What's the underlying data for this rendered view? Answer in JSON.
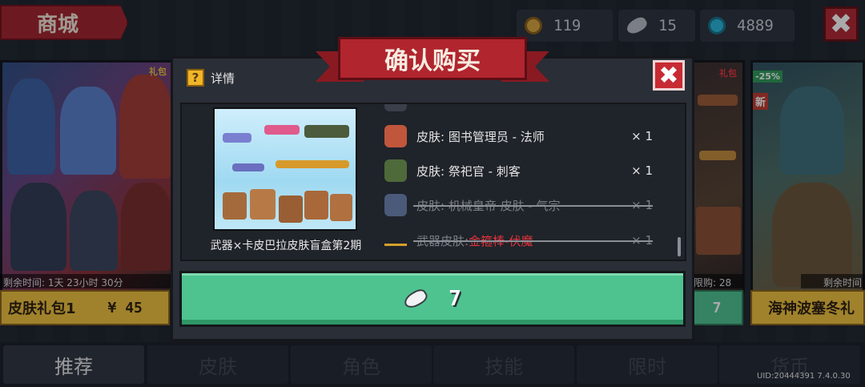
{
  "topbar": {
    "title": "商城",
    "currencies": [
      {
        "icon": "coin-icon",
        "value": "119"
      },
      {
        "icon": "fish-icon",
        "value": "15"
      },
      {
        "icon": "gem-icon",
        "value": "4889"
      }
    ],
    "close_label": "✖"
  },
  "background_cards": {
    "left": {
      "tag": "礼包",
      "remaining": "剩余时间: 1天 23小时 30分",
      "name": "皮肤礼包1",
      "price": "¥ 45"
    },
    "mid": {
      "tag": "礼包",
      "limit": "限购: 28",
      "price": "7"
    },
    "right": {
      "discount": "-25%",
      "new": "新",
      "remaining": "剩余时间",
      "name": "海神波塞冬礼"
    }
  },
  "dialog": {
    "banner": "确认购买",
    "header": "详情",
    "help_icon": "?",
    "close_label": "✖",
    "preview_name": "武器×卡皮巴拉皮肤盲盒第2期",
    "items": [
      {
        "label": "皮肤: 图书管理员 - 法师",
        "qty": "× 1",
        "struck": false
      },
      {
        "label": "皮肤: 祭祀官 - 刺客",
        "qty": "× 1",
        "struck": false
      },
      {
        "label": "皮肤: 机械皇帝 皮肤 - 气宗",
        "qty": "× 1",
        "struck": true
      },
      {
        "label_prefix": "武器皮肤: ",
        "label_highlight": "金箍棒-伏魔",
        "qty": "× 1",
        "struck": true
      }
    ],
    "buy": {
      "icon": "fish-icon",
      "price": "7"
    }
  },
  "tabs": [
    {
      "label": "推荐",
      "active": true
    },
    {
      "label": "皮肤",
      "active": false
    },
    {
      "label": "角色",
      "active": false
    },
    {
      "label": "技能",
      "active": false
    },
    {
      "label": "限时",
      "active": false
    },
    {
      "label": "货币",
      "active": false
    }
  ],
  "uid": "UID:20444391 7.4.0.30",
  "colors": {
    "accent_red": "#b0252e",
    "buy_green": "#4ec38f",
    "gold": "#f2c23b"
  }
}
